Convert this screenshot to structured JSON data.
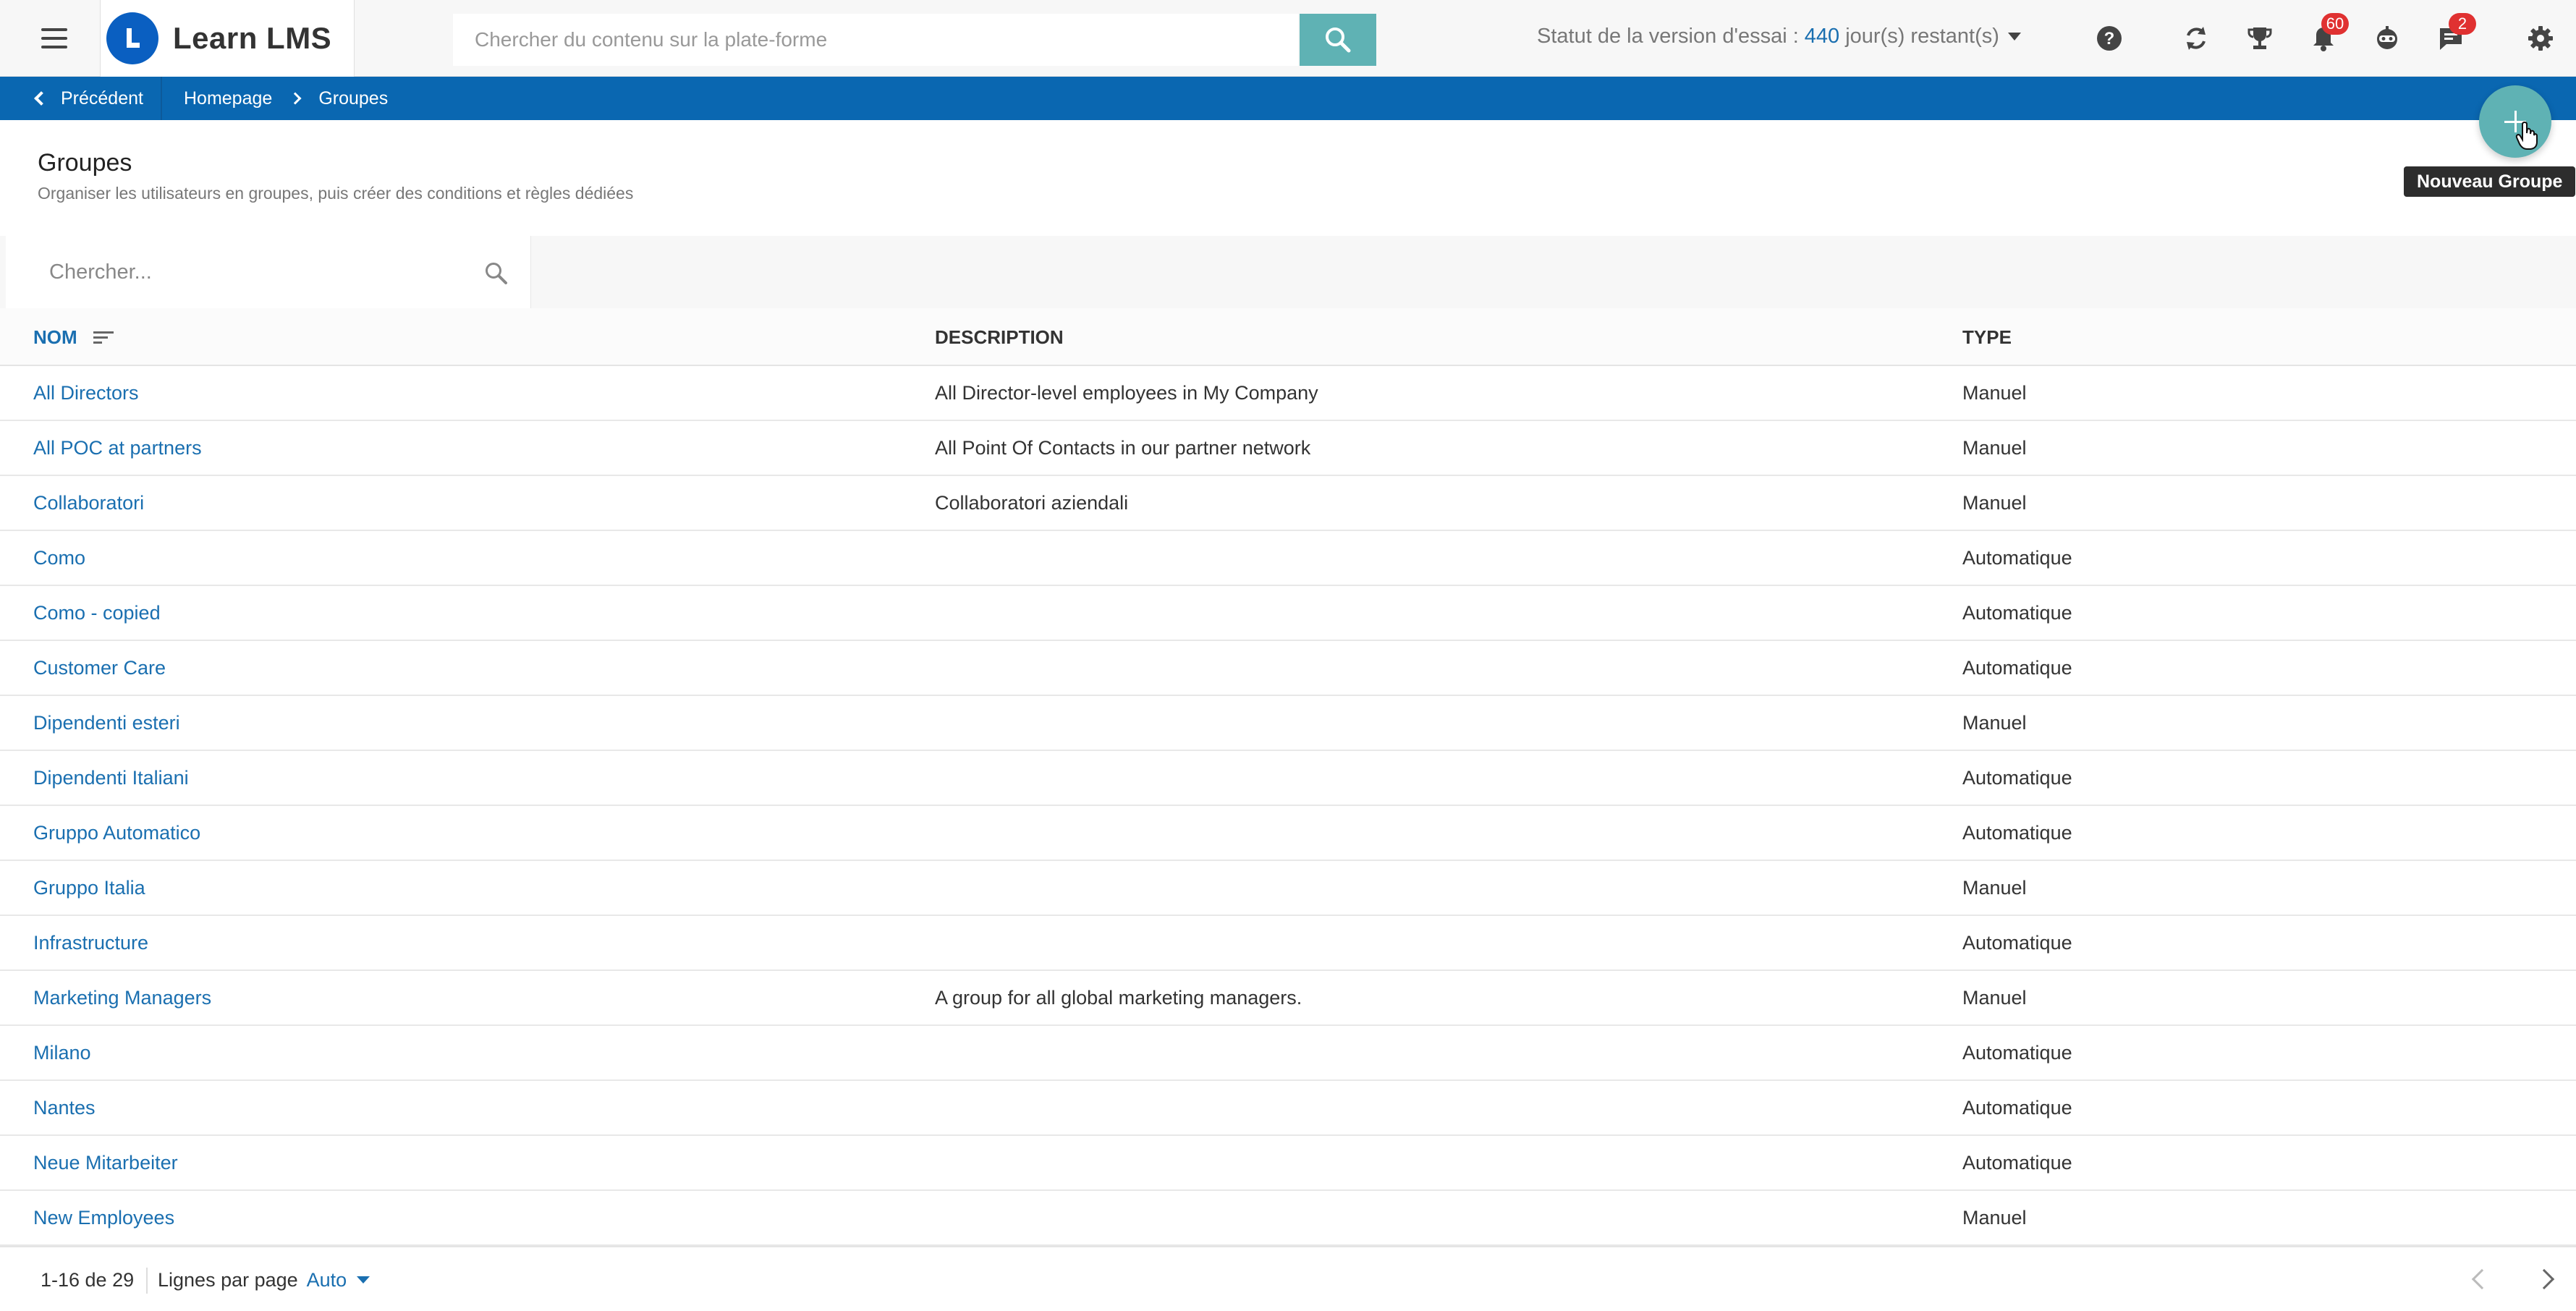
{
  "app": {
    "name": "Learn LMS",
    "search_placeholder": "Chercher du contenu sur la plate-forme"
  },
  "trial": {
    "label": "Statut de la version d'essai :",
    "days": "440",
    "suffix": "jour(s) restant(s)"
  },
  "header_icons": {
    "notifications_count": "60",
    "messages_count": "2"
  },
  "breadcrumb": {
    "back_label": "Précédent",
    "items": [
      "Homepage",
      "Groupes"
    ]
  },
  "fab": {
    "tooltip": "Nouveau Groupe"
  },
  "page": {
    "title": "Groupes",
    "subtitle": "Organiser les utilisateurs en groupes, puis créer des conditions et règles dédiées"
  },
  "filter": {
    "placeholder": "Chercher..."
  },
  "table": {
    "columns": [
      "NOM",
      "DESCRIPTION",
      "TYPE"
    ],
    "rows": [
      {
        "name": "All Directors",
        "description": "All Director-level employees in My Company",
        "type": "Manuel"
      },
      {
        "name": "All POC at partners",
        "description": "All Point Of Contacts in our partner network",
        "type": "Manuel"
      },
      {
        "name": "Collaboratori",
        "description": "Collaboratori aziendali",
        "type": "Manuel"
      },
      {
        "name": "Como",
        "description": "",
        "type": "Automatique"
      },
      {
        "name": "Como - copied",
        "description": "",
        "type": "Automatique"
      },
      {
        "name": "Customer Care",
        "description": "",
        "type": "Automatique"
      },
      {
        "name": "Dipendenti esteri",
        "description": "",
        "type": "Manuel"
      },
      {
        "name": "Dipendenti Italiani",
        "description": "",
        "type": "Automatique"
      },
      {
        "name": "Gruppo Automatico",
        "description": "",
        "type": "Automatique"
      },
      {
        "name": "Gruppo Italia",
        "description": "",
        "type": "Manuel"
      },
      {
        "name": "Infrastructure",
        "description": "",
        "type": "Automatique"
      },
      {
        "name": "Marketing Managers",
        "description": "A group for all global marketing managers.",
        "type": "Manuel"
      },
      {
        "name": "Milano",
        "description": "",
        "type": "Automatique"
      },
      {
        "name": "Nantes",
        "description": "",
        "type": "Automatique"
      },
      {
        "name": "Neue Mitarbeiter",
        "description": "",
        "type": "Automatique"
      },
      {
        "name": "New Employees",
        "description": "",
        "type": "Manuel"
      }
    ]
  },
  "footer": {
    "range": "1-16 de 29",
    "rows_per_page_label": "Lignes par page",
    "rows_per_page_value": "Auto"
  },
  "colors": {
    "accent": "#0a67b1",
    "teal": "#5fb2b4",
    "link": "#1a6fb0",
    "badge": "#e03131"
  }
}
